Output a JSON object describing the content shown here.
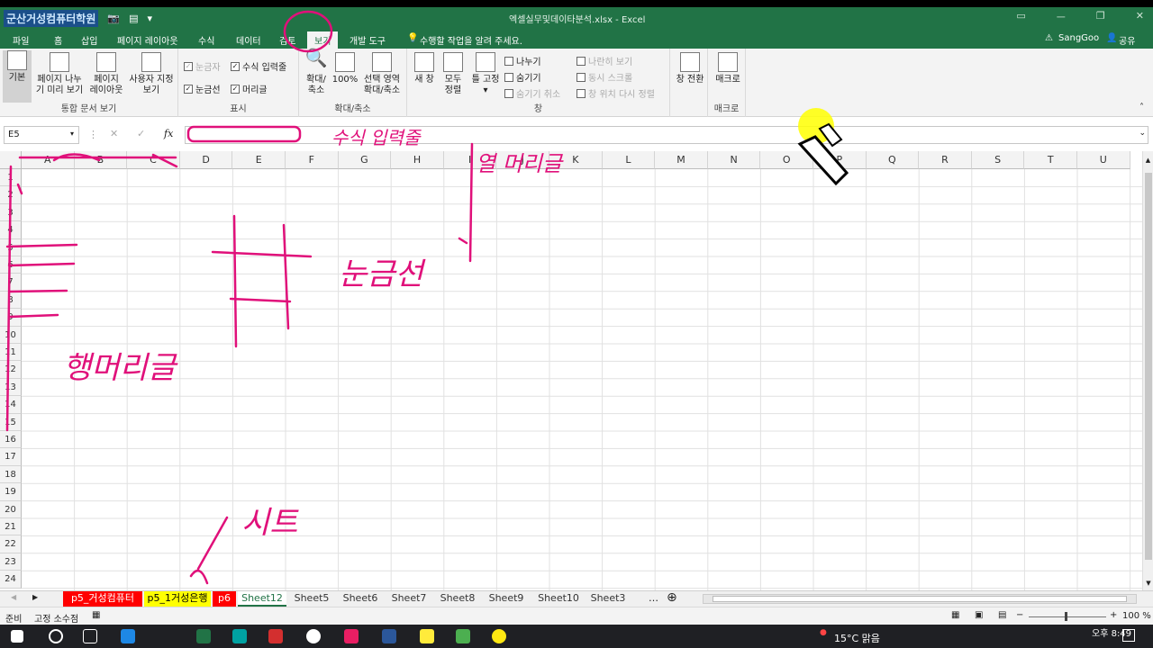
{
  "qat": {
    "logo": "군산거성컴퓨터학원"
  },
  "window": {
    "title": "엑셀실무및데이타분석.xlsx - Excel",
    "controls": [
      "ㅡ",
      "❐",
      "✕"
    ]
  },
  "tabs": [
    "파일",
    "홈",
    "삽입",
    "페이지 레이아웃",
    "수식",
    "데이터",
    "검토",
    "보기",
    "개발 도구"
  ],
  "tell_me": "수행할 작업을 알려 주세요.",
  "account": {
    "user": "SangGoo",
    "share": "공유"
  },
  "ribbon": {
    "g1": {
      "label": "통합 문서 보기",
      "b1": "기본",
      "b2a": "페이지 나누",
      "b2b": "기 미리 보기",
      "b3a": "페이지",
      "b3b": "레이아웃",
      "b4a": "사용자 지정",
      "b4b": "보기"
    },
    "g2": {
      "label": "표시",
      "ruler": "눈금자",
      "formula": "수식 입력줄",
      "grid": "눈금선",
      "headers": "머리글"
    },
    "g3": {
      "label": "확대/축소",
      "zoom_a": "확대/",
      "zoom_b": "축소",
      "z100": "100%",
      "sel_a": "선택 영역",
      "sel_b": "확대/축소"
    },
    "g4": {
      "label": "창",
      "new_a": "새 창",
      "all_a": "모두",
      "all_b": "정렬",
      "freeze": "틀 고정",
      "split": "나누기",
      "hide": "숨기기",
      "unhide": "숨기기 취소",
      "side": "나란히 보기",
      "sync": "동시 스크롤",
      "reset": "창 위치 다시 정렬",
      "switch": "창 전환"
    },
    "g5": {
      "label": "매크로",
      "macro": "매크로"
    }
  },
  "formula": {
    "namebox": "E5",
    "fx": "fx"
  },
  "columns": [
    "A",
    "B",
    "C",
    "D",
    "E",
    "F",
    "G",
    "H",
    "I",
    "J",
    "K",
    "L",
    "M",
    "N",
    "O",
    "P",
    "Q",
    "R",
    "S",
    "T",
    "U"
  ],
  "rows": [
    "1",
    "2",
    "3",
    "4",
    "5",
    "6",
    "7",
    "8",
    "9",
    "10",
    "11",
    "12",
    "13",
    "14",
    "15",
    "16",
    "17",
    "18",
    "19",
    "20",
    "21",
    "22",
    "23",
    "24"
  ],
  "sheets": [
    {
      "name": "p5_거성컴퓨터",
      "bg": "#ff0000",
      "fg": "#ffffff"
    },
    {
      "name": "p5_1거성은행",
      "bg": "#ffff00",
      "fg": "#000000"
    },
    {
      "name": "p6",
      "bg": "#ff0000",
      "fg": "#ffffff"
    },
    {
      "name": "Sheet12",
      "bg": "#ffffff",
      "fg": "#217346"
    },
    {
      "name": "Sheet5",
      "bg": "#f0f0f0",
      "fg": "#333333"
    },
    {
      "name": "Sheet6",
      "bg": "#f0f0f0",
      "fg": "#333333"
    },
    {
      "name": "Sheet7",
      "bg": "#f0f0f0",
      "fg": "#333333"
    },
    {
      "name": "Sheet8",
      "bg": "#f0f0f0",
      "fg": "#333333"
    },
    {
      "name": "Sheet9",
      "bg": "#f0f0f0",
      "fg": "#333333"
    },
    {
      "name": "Sheet10",
      "bg": "#f0f0f0",
      "fg": "#333333"
    },
    {
      "name": "Sheet3",
      "bg": "#f0f0f0",
      "fg": "#333333"
    }
  ],
  "status": {
    "ready": "준비",
    "fixed": "고정 소수점",
    "zoom": "100 %"
  },
  "taskbar": {
    "weather": "15°C 맑음",
    "time": "오후 8:49"
  },
  "annotations": {
    "formula_bar": "수식 입력줄",
    "col_header": "열 머리글",
    "gridlines": "눈금선",
    "row_header": "행머리글",
    "sheet": "시트"
  },
  "colors": {
    "excel_green": "#217346",
    "annotation_pink": "#e0107a"
  }
}
